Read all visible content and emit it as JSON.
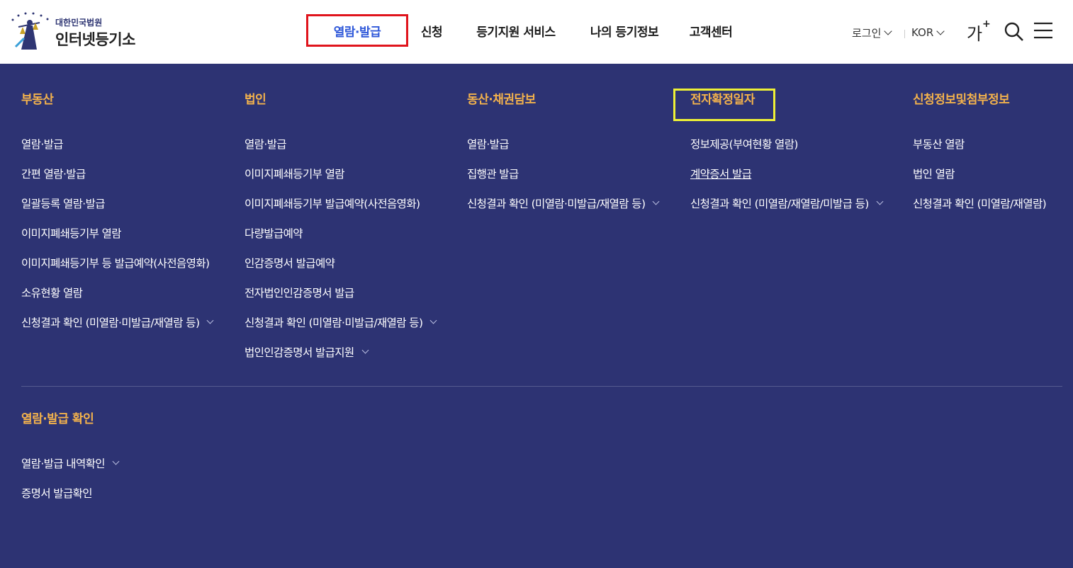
{
  "header": {
    "logo_sub": "대한민국법원",
    "logo_main": "인터넷등기소",
    "nav": [
      "열람·발급",
      "신청",
      "등기지원 서비스",
      "나의 등기정보",
      "고객센터"
    ],
    "login": "로그인",
    "lang": "KOR",
    "font_size": "가",
    "font_plus": "+"
  },
  "menu": {
    "columns": [
      {
        "title": "부동산",
        "items": [
          {
            "label": "열람·발급"
          },
          {
            "label": "간편 열람·발급"
          },
          {
            "label": "일괄등록 열람·발급"
          },
          {
            "label": "이미지폐쇄등기부 열람"
          },
          {
            "label": "이미지폐쇄등기부 등 발급예약(사전음영화)"
          },
          {
            "label": "소유현황 열람"
          },
          {
            "label": "신청결과 확인 (미열람·미발급/재열람 등)",
            "expandable": true
          }
        ]
      },
      {
        "title": "법인",
        "items": [
          {
            "label": "열람·발급"
          },
          {
            "label": "이미지폐쇄등기부 열람"
          },
          {
            "label": "이미지폐쇄등기부 발급예약(사전음영화)"
          },
          {
            "label": "다량발급예약"
          },
          {
            "label": "인감증명서 발급예약"
          },
          {
            "label": "전자법인인감증명서 발급"
          },
          {
            "label": "신청결과 확인 (미열람·미발급/재열람 등)",
            "expandable": true
          },
          {
            "label": "법인인감증명서 발급지원",
            "expandable": true
          }
        ]
      },
      {
        "title": "동산·채권담보",
        "items": [
          {
            "label": "열람·발급"
          },
          {
            "label": "집행관 발급"
          },
          {
            "label": "신청결과 확인 (미열람·미발급/재열람 등)",
            "expandable": true
          }
        ]
      },
      {
        "title": "전자확정일자",
        "items": [
          {
            "label": "정보제공(부여현황 열람)"
          },
          {
            "label": "계약증서 발급",
            "highlight": true
          },
          {
            "label": "신청결과 확인 (미열람/재열람/미발급 등)",
            "expandable": true
          }
        ]
      },
      {
        "title": "신청정보및첨부정보",
        "items": [
          {
            "label": "부동산 열람"
          },
          {
            "label": "법인 열람"
          },
          {
            "label": "신청결과 확인 (미열람/재열람)"
          }
        ]
      }
    ],
    "bottom": {
      "title": "열람·발급 확인",
      "items": [
        {
          "label": "열람·발급 내역확인",
          "expandable": true
        },
        {
          "label": "증명서 발급확인"
        }
      ]
    }
  },
  "colors": {
    "panel_bg": "#2d3373",
    "section_title": "#f3b24c",
    "active_nav": "#2f58d9",
    "red_outline": "#e0141c",
    "yellow_outline": "#eef036"
  }
}
